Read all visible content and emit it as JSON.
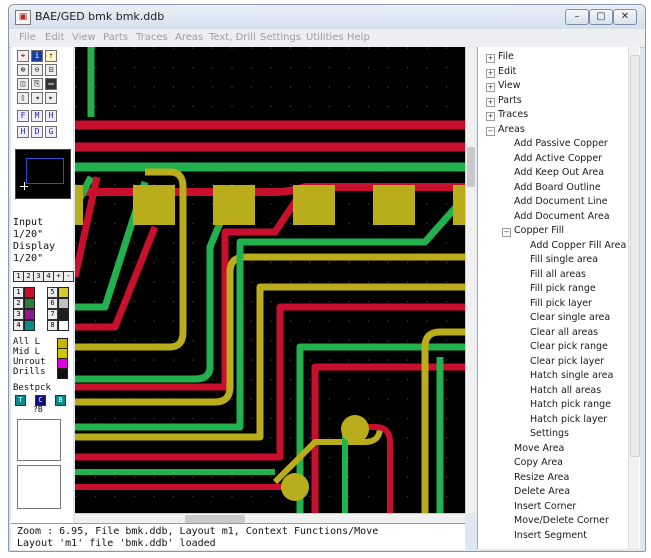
{
  "window": {
    "title": "BAE/GED bmk bmk.ddb",
    "minimize": "–",
    "maximize": "▢",
    "close": "✕"
  },
  "menu": [
    "File",
    "Edit",
    "View",
    "Parts",
    "Traces",
    "Areas",
    "Text, Drill",
    "Settings",
    "Utilities",
    "Help"
  ],
  "toolbar": {
    "row1": [
      "⌖",
      "i",
      "⇡"
    ],
    "row2": [
      "⊕",
      "⊖",
      "⊡"
    ],
    "row3": [
      "◫",
      "⎘",
      "▭"
    ],
    "row4": [
      "▯",
      "◂",
      "▸"
    ],
    "row5": [
      "F",
      "M",
      "H"
    ],
    "row6": [
      "H",
      "D",
      "G"
    ]
  },
  "grid": {
    "input_label": "Input",
    "input_value": "1/20\"",
    "display_label": "Display",
    "display_value": "1/20\""
  },
  "layer_buttons": [
    "1",
    "2",
    "3",
    "4",
    "+",
    "-"
  ],
  "layers": {
    "left": [
      "1",
      "2",
      "3",
      "4"
    ],
    "right": [
      "5",
      "6",
      "7",
      "8"
    ],
    "left_colors": [
      "#c8102e",
      "#2e7d32",
      "#8e1b8e",
      "#0a8a8a"
    ],
    "right_colors": [
      "#d6ca2a",
      "#c0c0c0",
      "#1f1f1f",
      "#ffffff"
    ]
  },
  "special_layers": [
    {
      "label": "All L",
      "color": "#c8b400"
    },
    {
      "label": "Mid L",
      "color": "#d4c400"
    },
    {
      "label": "Unrout",
      "color": "#e000e0"
    },
    {
      "label": "Drills",
      "color": "#111111"
    }
  ],
  "bestpack": {
    "label": "Bestpck",
    "items": [
      "T",
      "C",
      "B"
    ],
    "sub": "?B"
  },
  "status": {
    "line1": "Zoom  : 6.95, File bmk.ddb, Layout m1, Context Functions/Move",
    "line2": "Layout 'm1' file 'bmk.ddb' loaded"
  },
  "colors": {
    "copper_red": "#c8102e",
    "copper_green": "#22b14c",
    "pad_yellow": "#b9ad1c",
    "grid_dot": "#3a3a3a"
  },
  "tree": [
    {
      "label": "File",
      "level": 0,
      "exp": "+"
    },
    {
      "label": "Edit",
      "level": 0,
      "exp": "+"
    },
    {
      "label": "View",
      "level": 0,
      "exp": "+"
    },
    {
      "label": "Parts",
      "level": 0,
      "exp": "+"
    },
    {
      "label": "Traces",
      "level": 0,
      "exp": "+"
    },
    {
      "label": "Areas",
      "level": 0,
      "exp": "−"
    },
    {
      "label": "Add Passive Copper",
      "level": 1
    },
    {
      "label": "Add Active Copper",
      "level": 1
    },
    {
      "label": "Add Keep Out Area",
      "level": 1
    },
    {
      "label": "Add Board Outline",
      "level": 1
    },
    {
      "label": "Add Document Line",
      "level": 1
    },
    {
      "label": "Add Document Area",
      "level": 1
    },
    {
      "label": "Copper Fill",
      "level": 1,
      "exp": "−"
    },
    {
      "label": "Add Copper Fill Area",
      "level": 2
    },
    {
      "label": "Fill single area",
      "level": 2
    },
    {
      "label": "Fill all areas",
      "level": 2
    },
    {
      "label": "Fill pick range",
      "level": 2
    },
    {
      "label": "Fill pick layer",
      "level": 2
    },
    {
      "label": "Clear single area",
      "level": 2
    },
    {
      "label": "Clear all areas",
      "level": 2
    },
    {
      "label": "Clear pick range",
      "level": 2
    },
    {
      "label": "Clear pick layer",
      "level": 2
    },
    {
      "label": "Hatch single area",
      "level": 2
    },
    {
      "label": "Hatch all areas",
      "level": 2
    },
    {
      "label": "Hatch pick range",
      "level": 2
    },
    {
      "label": "Hatch pick layer",
      "level": 2
    },
    {
      "label": "Settings",
      "level": 2
    },
    {
      "label": "Move Area",
      "level": 1
    },
    {
      "label": "Copy Area",
      "level": 1
    },
    {
      "label": "Resize Area",
      "level": 1
    },
    {
      "label": "Delete Area",
      "level": 1
    },
    {
      "label": "Insert Corner",
      "level": 1
    },
    {
      "label": "Move/Delete Corner",
      "level": 1
    },
    {
      "label": "Insert Segment",
      "level": 1
    }
  ]
}
